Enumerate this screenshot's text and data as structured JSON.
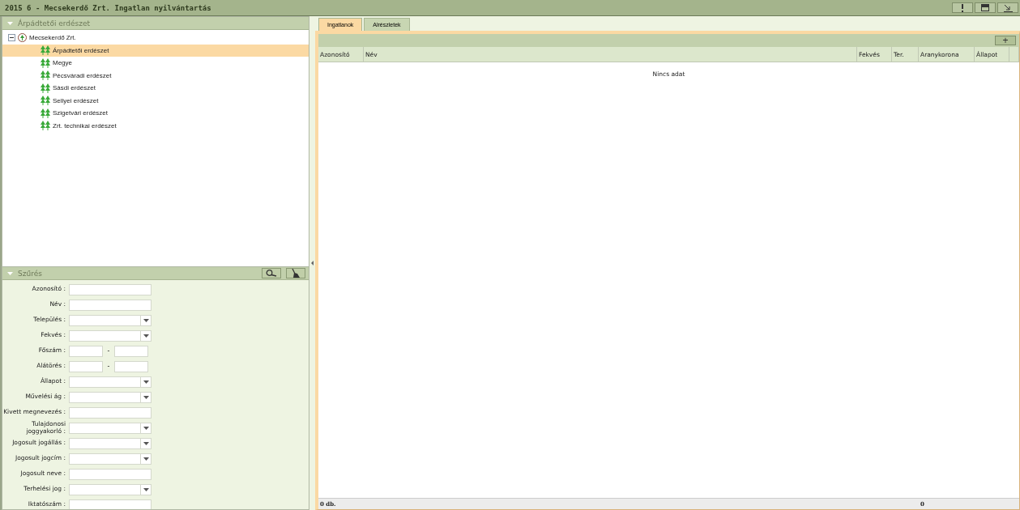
{
  "window": {
    "title": "2015 6 - Mecsekerdő Zrt. Ingatlan nyilvántartás"
  },
  "tree_panel": {
    "title": "Árpádtetői erdészet",
    "root": {
      "label": "Mecsekerdő Zrt.",
      "expanded": true,
      "children": [
        {
          "label": "Árpádtetői erdészet",
          "selected": true
        },
        {
          "label": "Megye",
          "selected": false
        },
        {
          "label": "Pécsváradi erdészet",
          "selected": false
        },
        {
          "label": "Sásdi erdészet",
          "selected": false
        },
        {
          "label": "Sellyei erdészet",
          "selected": false
        },
        {
          "label": "Szigetvári erdészet",
          "selected": false
        },
        {
          "label": "Zrt. technikai erdészet",
          "selected": false
        }
      ]
    }
  },
  "filter_panel": {
    "title": "Szűrés",
    "fields": [
      {
        "kind": "text",
        "label": "Azonosító :"
      },
      {
        "kind": "text",
        "label": "Név :"
      },
      {
        "kind": "select",
        "label": "Település :"
      },
      {
        "kind": "select",
        "label": "Fekvés :"
      },
      {
        "kind": "range",
        "label": "Főszám :",
        "separator": "-"
      },
      {
        "kind": "range",
        "label": "Alátörés :",
        "separator": "-"
      },
      {
        "kind": "select",
        "label": "Állapot :"
      },
      {
        "kind": "select",
        "label": "Művelési ág :"
      },
      {
        "kind": "text",
        "label": "Kivett megnevezés :"
      },
      {
        "kind": "select",
        "label": "Tulajdonosi joggyakorló :"
      },
      {
        "kind": "select",
        "label": "Jogosult jogállás :"
      },
      {
        "kind": "select",
        "label": "Jogosult jogcím :"
      },
      {
        "kind": "text",
        "label": "Jogosult neve :"
      },
      {
        "kind": "select",
        "label": "Terhelési jog :"
      },
      {
        "kind": "text",
        "label": "Iktatószám :"
      }
    ]
  },
  "tabs": [
    {
      "label": "Ingatlanok",
      "selected": true
    },
    {
      "label": "Alrészletek",
      "selected": false
    }
  ],
  "toolbar": {
    "add_button": "+"
  },
  "table": {
    "columns": [
      "Azonosító",
      "Név",
      "Fekvés",
      "Ter.",
      "Aranykorona",
      "Állapot"
    ],
    "empty_message": "Nincs adat"
  },
  "footer": {
    "count": "0 db.",
    "aranykorona_total": "0"
  }
}
